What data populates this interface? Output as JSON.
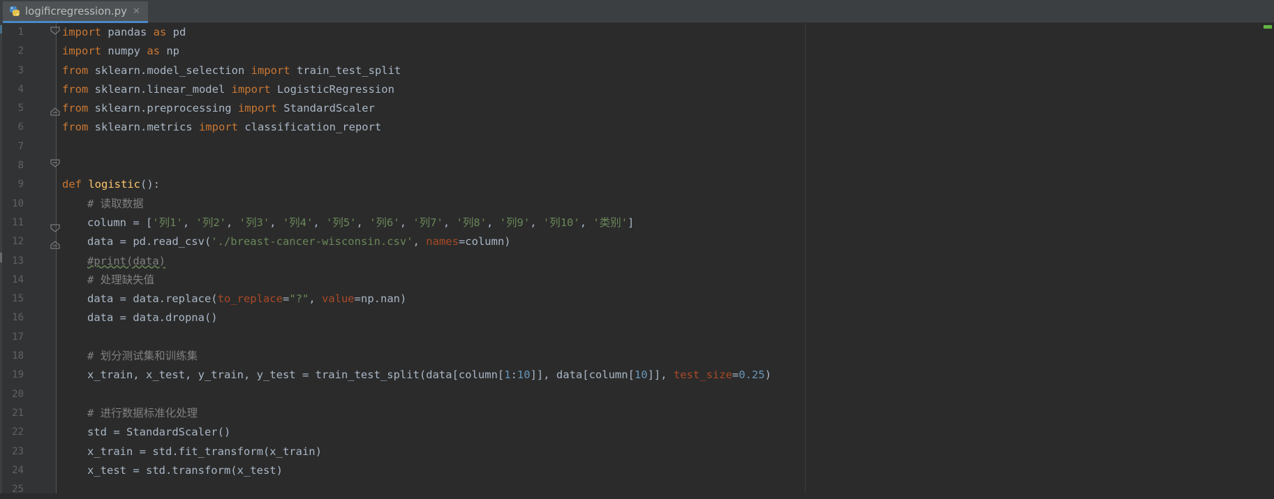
{
  "tab": {
    "filename": "logificregression.py",
    "close_glyph": "✕"
  },
  "colors": {
    "keyword": "#cc7832",
    "function": "#ffc66d",
    "comment": "#808080",
    "string": "#6a8759",
    "number": "#6897bb",
    "param": "#aa4926",
    "text": "#a9b7c6",
    "background": "#2b2b2b"
  },
  "editor": {
    "line_numbers": [
      "1",
      "2",
      "3",
      "4",
      "5",
      "6",
      "7",
      "8",
      "9",
      "10",
      "11",
      "12",
      "13",
      "14",
      "15",
      "16",
      "17",
      "18",
      "19",
      "20",
      "21",
      "22",
      "23",
      "24",
      "25"
    ],
    "lines": {
      "l1": [
        "import",
        " pandas ",
        "as",
        " pd"
      ],
      "l2": [
        "import",
        " numpy ",
        "as",
        " np"
      ],
      "l3": [
        "from",
        " sklearn.model_selection ",
        "import",
        " train_test_split"
      ],
      "l4": [
        "from",
        " sklearn.linear_model ",
        "import",
        " LogisticRegression"
      ],
      "l5": [
        "from",
        " sklearn.preprocessing ",
        "import",
        " StandardScaler"
      ],
      "l6": [
        "from",
        " sklearn.metrics ",
        "import",
        " classification_report"
      ],
      "l9": [
        "def",
        " ",
        "logistic",
        "():"
      ],
      "l10": [
        "# 读取数据"
      ],
      "l11": [
        "column = [",
        "'列1'",
        ", ",
        "'列2'",
        ", ",
        "'列3'",
        ", ",
        "'列4'",
        ", ",
        "'列5'",
        ", ",
        "'列6'",
        ", ",
        "'列7'",
        ", ",
        "'列8'",
        ", ",
        "'列9'",
        ", ",
        "'列10'",
        ", ",
        "'类别'",
        "]"
      ],
      "l12": [
        "data = pd.read_csv(",
        "'./breast-cancer-wisconsin.csv'",
        ", ",
        "names",
        "=column)"
      ],
      "l13": [
        "#print(data)"
      ],
      "l14": [
        "# 处理缺失值"
      ],
      "l15": [
        "data = data.replace(",
        "to_replace",
        "=",
        "\"?\"",
        ", ",
        "value",
        "=np.nan)"
      ],
      "l16": [
        "data = data.dropna()"
      ],
      "l18": [
        "# 划分测试集和训练集"
      ],
      "l19": [
        "x_train, x_test, y_train, y_test = train_test_split(data[column[",
        "1",
        ":",
        "10",
        "]], data[column[",
        "10",
        "]], ",
        "test_size",
        "=",
        "0.25",
        ")"
      ],
      "l21": [
        "# 进行数据标准化处理"
      ],
      "l22": [
        "std = StandardScaler()"
      ],
      "l23": [
        "x_train = std.fit_transform(x_train)"
      ],
      "l24": [
        "x_test = std.transform(x_test)"
      ]
    }
  }
}
